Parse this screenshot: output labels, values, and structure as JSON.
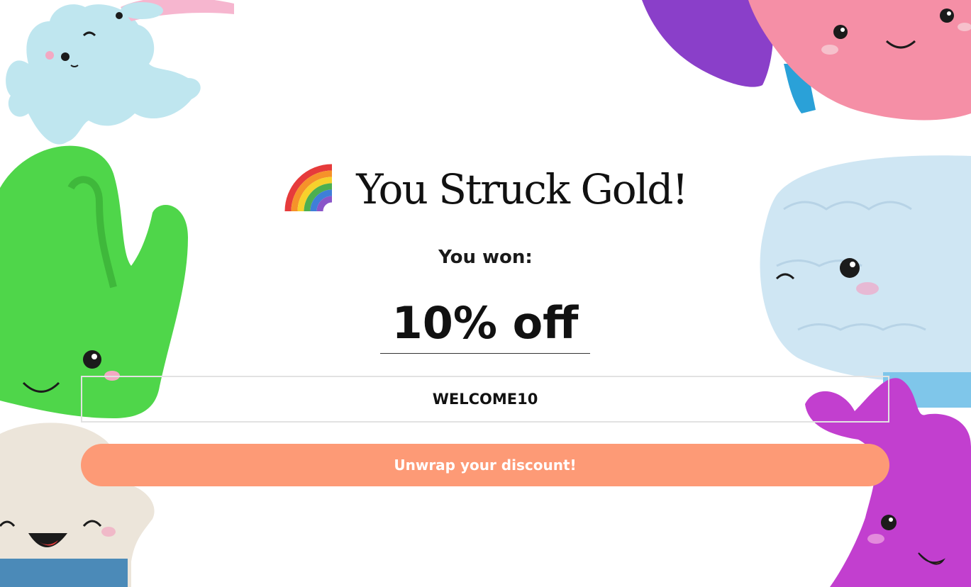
{
  "popup": {
    "title_emoji_icon": "rainbow-icon",
    "title": "You Struck Gold!",
    "won_label": "You won:",
    "prize": "10% off",
    "discount_code": "WELCOME10",
    "cta_label": "Unwrap your discount!"
  },
  "decorations": [
    "axolotl-plush",
    "liver-plush",
    "brain-plush",
    "gallbladder-plush",
    "stomach-plush",
    "bone-plush"
  ],
  "colors": {
    "background": "#ffffff",
    "cta_background": "#fd9a76",
    "cta_text": "#ffffff",
    "code_border": "#e2e2e2",
    "text": "#111111"
  }
}
